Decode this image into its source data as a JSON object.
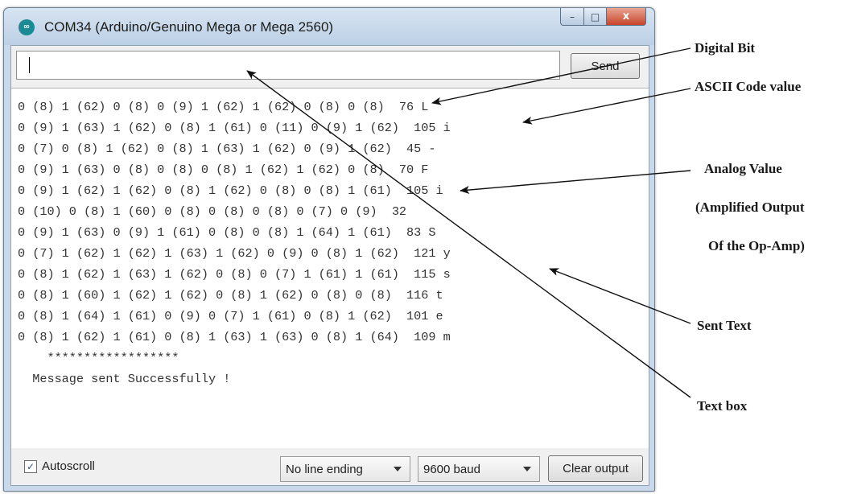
{
  "window": {
    "title": "COM34 (Arduino/Genuino Mega or Mega 2560)",
    "app_icon_text": "∞",
    "controls": {
      "minimize": "–",
      "maximize": "□",
      "close": "x"
    }
  },
  "input": {
    "value": "",
    "send_label": "Send"
  },
  "serial_output": [
    "0 (8) 1 (62) 0 (8) 0 (9) 1 (62) 1 (62) 0 (8) 0 (8)  76 L",
    "0 (9) 1 (63) 1 (62) 0 (8) 1 (61) 0 (11) 0 (9) 1 (62)  105 i",
    "0 (7) 0 (8) 1 (62) 0 (8) 1 (63) 1 (62) 0 (9) 1 (62)  45 -",
    "0 (9) 1 (63) 0 (8) 0 (8) 0 (8) 1 (62) 1 (62) 0 (8)  70 F",
    "0 (9) 1 (62) 1 (62) 0 (8) 1 (62) 0 (8) 0 (8) 1 (61)  105 i",
    "0 (10) 0 (8) 1 (60) 0 (8) 0 (8) 0 (8) 0 (7) 0 (9)  32",
    "0 (9) 1 (63) 0 (9) 1 (61) 0 (8) 0 (8) 1 (64) 1 (61)  83 S",
    "0 (7) 1 (62) 1 (62) 1 (63) 1 (62) 0 (9) 0 (8) 1 (62)  121 y",
    "0 (8) 1 (62) 1 (63) 1 (62) 0 (8) 0 (7) 1 (61) 1 (61)  115 s",
    "0 (8) 1 (60) 1 (62) 1 (62) 0 (8) 1 (62) 0 (8) 0 (8)  116 t",
    "0 (8) 1 (64) 1 (61) 0 (9) 0 (7) 1 (61) 0 (8) 1 (62)  101 e",
    "0 (8) 1 (62) 1 (61) 0 (8) 1 (63) 1 (63) 0 (8) 1 (64)  109 m",
    "    ******************",
    "  Message sent Successfully !"
  ],
  "bottom_bar": {
    "autoscroll_label": "Autoscroll",
    "autoscroll_checked": true,
    "line_ending": "No line ending",
    "baud_rate": "9600 baud",
    "clear_label": "Clear output"
  },
  "annotations": {
    "digital_bit": "Digital Bit",
    "ascii_code": "ASCII Code value",
    "analog_value": "Analog Value",
    "amplified_line1": "(Amplified Output",
    "amplified_line2": "Of the Op-Amp)",
    "sent_text": "Sent Text",
    "text_box": "Text box"
  }
}
